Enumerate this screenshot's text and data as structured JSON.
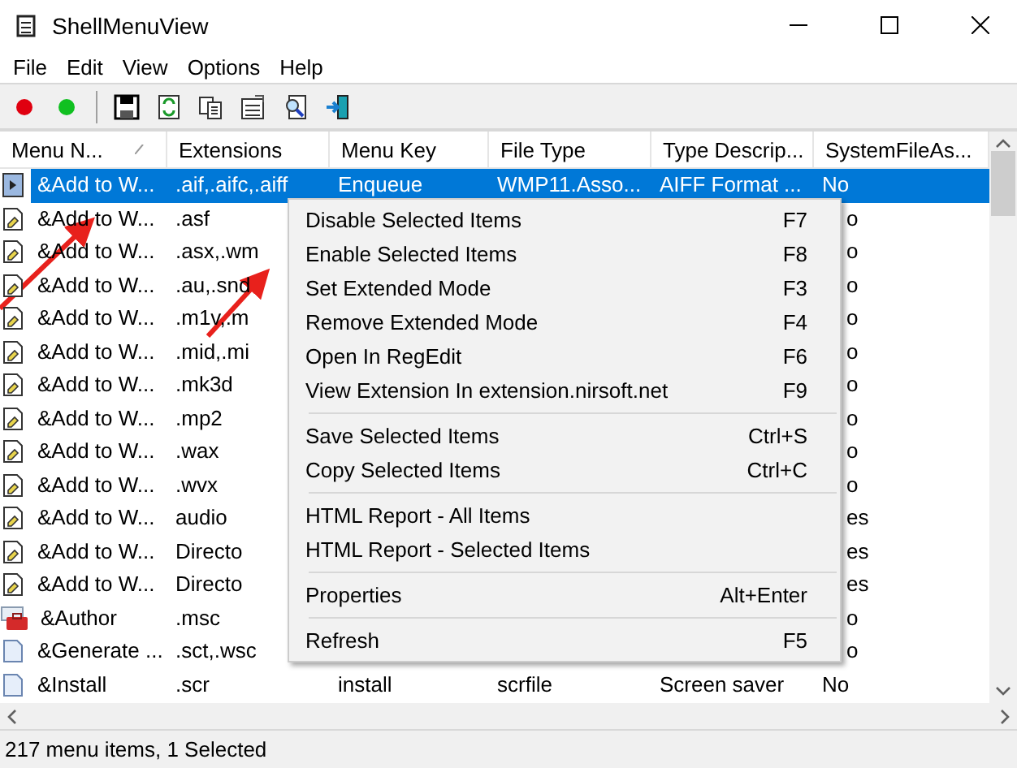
{
  "window": {
    "title": "ShellMenuView"
  },
  "menu_bar": [
    "File",
    "Edit",
    "View",
    "Options",
    "Help"
  ],
  "columns": [
    {
      "label": "Menu N...",
      "sorted": true
    },
    {
      "label": "Extensions",
      "sorted": false
    },
    {
      "label": "Menu Key",
      "sorted": false
    },
    {
      "label": "File Type",
      "sorted": false
    },
    {
      "label": "Type Descrip...",
      "sorted": false
    },
    {
      "label": "SystemFileAs...",
      "sorted": false
    }
  ],
  "rows": [
    {
      "kind": "shortcut",
      "selected": true,
      "cells": [
        "&Add to W...",
        ".aif,.aifc,.aiff",
        "Enqueue",
        "WMP11.Asso...",
        "AIFF Format ...",
        "No"
      ]
    },
    {
      "kind": "script",
      "selected": false,
      "cells": [
        "&Add to W...",
        ".asf",
        "",
        "",
        "",
        "o"
      ]
    },
    {
      "kind": "script",
      "selected": false,
      "cells": [
        "&Add to W...",
        ".asx,.wm",
        "",
        "",
        "",
        "o"
      ]
    },
    {
      "kind": "script",
      "selected": false,
      "cells": [
        "&Add to W...",
        ".au,.snd",
        "",
        "",
        "",
        "o"
      ]
    },
    {
      "kind": "script",
      "selected": false,
      "cells": [
        "&Add to W...",
        ".m1v,.m",
        "",
        "",
        "",
        "o"
      ]
    },
    {
      "kind": "script",
      "selected": false,
      "cells": [
        "&Add to W...",
        ".mid,.mi",
        "",
        "",
        "",
        "o"
      ]
    },
    {
      "kind": "script",
      "selected": false,
      "cells": [
        "&Add to W...",
        ".mk3d",
        "",
        "",
        "",
        "o"
      ]
    },
    {
      "kind": "script",
      "selected": false,
      "cells": [
        "&Add to W...",
        ".mp2",
        "",
        "",
        "",
        "o"
      ]
    },
    {
      "kind": "script",
      "selected": false,
      "cells": [
        "&Add to W...",
        ".wax",
        "",
        "",
        "",
        "o"
      ]
    },
    {
      "kind": "script",
      "selected": false,
      "cells": [
        "&Add to W...",
        ".wvx",
        "",
        "",
        "",
        "o"
      ]
    },
    {
      "kind": "script",
      "selected": false,
      "cells": [
        "&Add to W...",
        "audio",
        "",
        "",
        "",
        "es"
      ]
    },
    {
      "kind": "script",
      "selected": false,
      "cells": [
        "&Add to W...",
        "Directo",
        "",
        "",
        "",
        "es"
      ]
    },
    {
      "kind": "script",
      "selected": false,
      "cells": [
        "&Add to W...",
        "Directo",
        "",
        "",
        "",
        "es"
      ]
    },
    {
      "kind": "toolbox",
      "selected": false,
      "cells": [
        "&Author",
        ".msc",
        "",
        "",
        "",
        "o"
      ]
    },
    {
      "kind": "page",
      "selected": false,
      "cells": [
        "&Generate ...",
        ".sct,.wsc",
        "",
        "",
        "",
        "o"
      ]
    },
    {
      "kind": "page",
      "selected": false,
      "cells": [
        "&Install",
        ".scr",
        "install",
        "scrfile",
        "Screen saver",
        "No"
      ]
    }
  ],
  "context_menu": {
    "groups": [
      [
        {
          "label": "Disable Selected Items",
          "shortcut": "F7"
        },
        {
          "label": "Enable Selected Items",
          "shortcut": "F8"
        },
        {
          "label": "Set Extended Mode",
          "shortcut": "F3"
        },
        {
          "label": "Remove Extended Mode",
          "shortcut": "F4"
        },
        {
          "label": "Open In RegEdit",
          "shortcut": "F6"
        },
        {
          "label": "View Extension In extension.nirsoft.net",
          "shortcut": "F9"
        }
      ],
      [
        {
          "label": "Save Selected Items",
          "shortcut": "Ctrl+S"
        },
        {
          "label": "Copy Selected Items",
          "shortcut": "Ctrl+C"
        }
      ],
      [
        {
          "label": "HTML Report - All Items"
        },
        {
          "label": "HTML Report - Selected Items"
        }
      ],
      [
        {
          "label": "Properties",
          "shortcut": "Alt+Enter"
        }
      ],
      [
        {
          "label": "Refresh",
          "shortcut": "F5"
        }
      ]
    ]
  },
  "status_bar": "217 menu items, 1 Selected"
}
